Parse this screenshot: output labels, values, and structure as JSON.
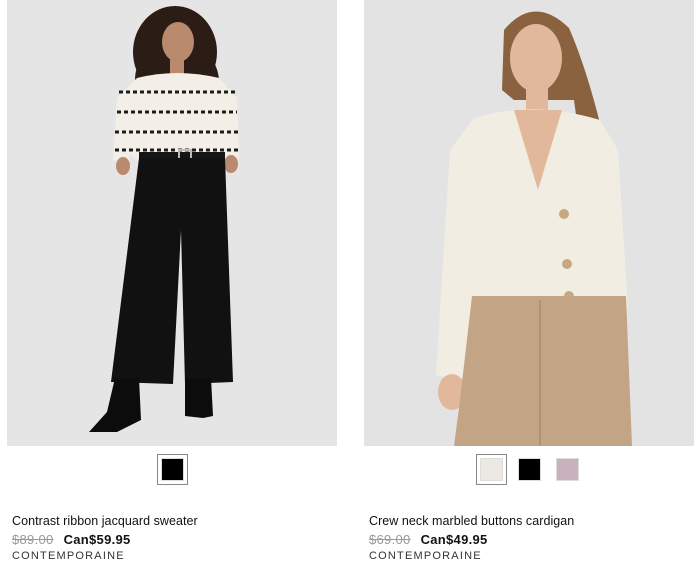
{
  "products": [
    {
      "name": "Contrast ribbon jacquard sweater",
      "old_price": "$89.00",
      "new_price": "Can$59.95",
      "brand": "CONTEMPORAINE",
      "swatches": [
        {
          "color": "#000000",
          "selected": true
        }
      ]
    },
    {
      "name": "Crew neck marbled buttons cardigan",
      "old_price": "$69.00",
      "new_price": "Can$49.95",
      "brand": "CONTEMPORAINE",
      "swatches": [
        {
          "color": "#ece9e2",
          "selected": true
        },
        {
          "color": "#000000",
          "selected": false
        },
        {
          "color": "#c8b2bd",
          "selected": false
        }
      ]
    }
  ]
}
